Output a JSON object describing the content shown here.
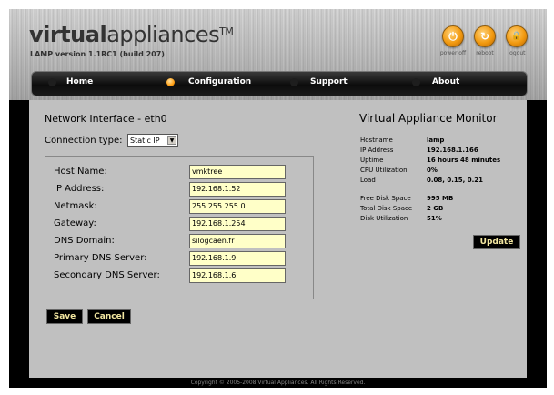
{
  "header": {
    "logo_bold": "virtual",
    "logo_light": "appliances",
    "logo_tm": "TM",
    "version": "LAMP version 1.1RC1 (build 207)"
  },
  "controls": [
    {
      "label": "power off",
      "icon": "power-icon",
      "glyph": "⏻"
    },
    {
      "label": "reboot",
      "icon": "reboot-icon",
      "glyph": "↻"
    },
    {
      "label": "logout",
      "icon": "lock-icon",
      "glyph": "🔒"
    }
  ],
  "nav": {
    "home": "Home",
    "configuration": "Configuration",
    "support": "Support",
    "about": "About",
    "active": "Configuration"
  },
  "network": {
    "title": "Network Interface - eth0",
    "connection_type_label": "Connection type:",
    "connection_type_value": "Static IP",
    "fields": [
      {
        "label": "Host Name:",
        "value": "vmktree"
      },
      {
        "label": "IP Address:",
        "value": "192.168.1.52"
      },
      {
        "label": "Netmask:",
        "value": "255.255.255.0"
      },
      {
        "label": "Gateway:",
        "value": "192.168.1.254"
      },
      {
        "label": "DNS Domain:",
        "value": "silogcaen.fr"
      },
      {
        "label": "Primary DNS Server:",
        "value": "192.168.1.9"
      },
      {
        "label": "Secondary DNS Server:",
        "value": "192.168.1.6"
      }
    ],
    "save_label": "Save",
    "cancel_label": "Cancel"
  },
  "monitor": {
    "title": "Virtual Appliance Monitor",
    "rows": [
      {
        "key": "Hostname",
        "value": "lamp"
      },
      {
        "key": "IP Address",
        "value": "192.168.1.166"
      },
      {
        "key": "Uptime",
        "value": "16 hours 48 minutes"
      },
      {
        "key": "CPU Utilization",
        "value": "0%"
      },
      {
        "key": "Load",
        "value": "0.08, 0.15, 0.21"
      }
    ],
    "disk_rows": [
      {
        "key": "Free Disk Space",
        "value": "995 MB"
      },
      {
        "key": "Total Disk Space",
        "value": "2 GB"
      },
      {
        "key": "Disk Utilization",
        "value": "51%"
      }
    ],
    "update_label": "Update"
  },
  "footer": {
    "copyright": "Copyright © 2005-2008 Virtual Appliances. All Rights Reserved."
  },
  "colors": {
    "accent_orange": "#f29a10",
    "input_bg": "#ffffc8",
    "button_text": "#f2e6a0"
  }
}
